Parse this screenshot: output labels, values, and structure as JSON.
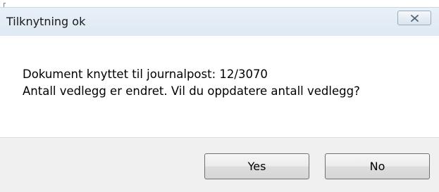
{
  "window": {
    "title": "Tilknytning ok",
    "close_icon": "close-x-icon"
  },
  "message": {
    "line1": "Dokument knyttet til journalpost: 12/3070",
    "line2": "Antall vedlegg er endret. Vil du oppdatere antall vedlegg?"
  },
  "buttons": {
    "yes_label": "Yes",
    "no_label": "No"
  },
  "colors": {
    "title_bar": "#dfe9f3",
    "button_area": "#f0f0f0",
    "close_border": "#9aaabb"
  }
}
